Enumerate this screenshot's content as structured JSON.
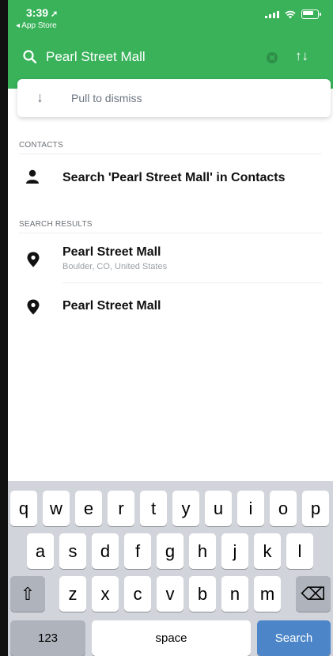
{
  "status_bar": {
    "time": "3:39",
    "location_arrow": "➚",
    "back_label": "◂ App Store"
  },
  "search": {
    "query": "Pearl Street Mall",
    "swap_symbol": "↑↓"
  },
  "pull_card": {
    "icon_symbol": "↓",
    "label": "Pull to dismiss"
  },
  "contacts_section": {
    "header": "CONTACTS",
    "row_label": "Search 'Pearl Street Mall' in Contacts"
  },
  "results_section": {
    "header": "SEARCH RESULTS",
    "items": [
      {
        "title": "Pearl Street Mall",
        "subtitle": "Boulder, CO, United States"
      },
      {
        "title": "Pearl Street Mall",
        "subtitle": ""
      }
    ]
  },
  "keyboard": {
    "row1": [
      "q",
      "w",
      "e",
      "r",
      "t",
      "y",
      "u",
      "i",
      "o",
      "p"
    ],
    "row2": [
      "a",
      "s",
      "d",
      "f",
      "g",
      "h",
      "j",
      "k",
      "l"
    ],
    "row3": [
      "z",
      "x",
      "c",
      "v",
      "b",
      "n",
      "m"
    ],
    "shift_symbol": "⇧",
    "delete_symbol": "⌫",
    "numbers_label": "123",
    "space_label": "space",
    "search_label": "Search"
  },
  "colors": {
    "header_green": "#39b25a",
    "search_key_blue": "#4c86c8"
  }
}
